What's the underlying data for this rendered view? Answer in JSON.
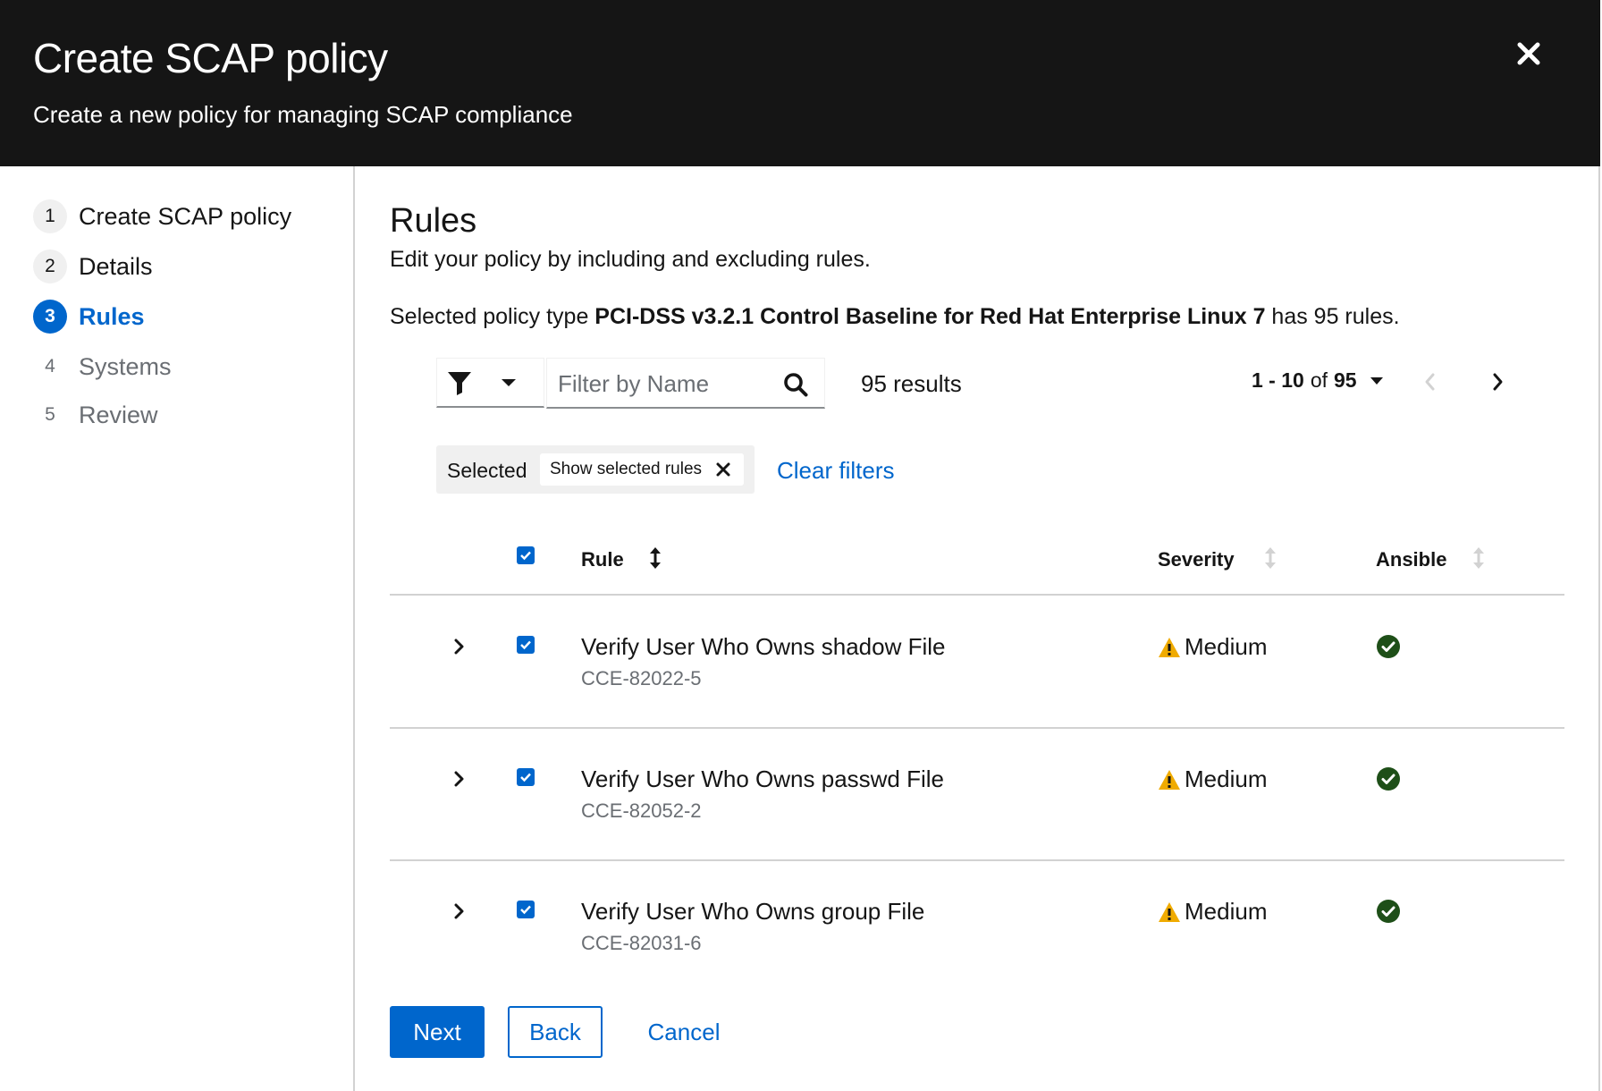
{
  "modal": {
    "title": "Create SCAP policy",
    "description": "Create a new policy for managing SCAP compliance"
  },
  "wizard_nav": {
    "items": [
      {
        "number": "1",
        "label": "Create SCAP policy",
        "state": "completed"
      },
      {
        "number": "2",
        "label": "Details",
        "state": "completed"
      },
      {
        "number": "3",
        "label": "Rules",
        "state": "current"
      },
      {
        "number": "4",
        "label": "Systems",
        "state": "disabled"
      },
      {
        "number": "5",
        "label": "Review",
        "state": "disabled"
      }
    ]
  },
  "main": {
    "title": "Rules",
    "description": "Edit your policy by including and excluding rules.",
    "policy_prefix": "Selected policy type ",
    "policy_name": "PCI-DSS v3.2.1 Control Baseline for Red Hat Enterprise Linux 7",
    "policy_suffix": " has 95 rules."
  },
  "toolbar": {
    "search_placeholder": "Filter by Name",
    "search_value": "",
    "results_text": "95 results",
    "pagination": {
      "range": "1 - 10",
      "of_text": "of",
      "total": "95"
    }
  },
  "filters": {
    "group_label": "Selected",
    "chip_label": "Show selected rules",
    "clear_label": "Clear filters"
  },
  "table": {
    "columns": {
      "rule": "Rule",
      "severity": "Severity",
      "ansible": "Ansible"
    },
    "rows": [
      {
        "name": "Verify User Who Owns shadow File",
        "id": "CCE-82022-5",
        "severity": "Medium",
        "checked": true,
        "ansible": true
      },
      {
        "name": "Verify User Who Owns passwd File",
        "id": "CCE-82052-2",
        "severity": "Medium",
        "checked": true,
        "ansible": true
      },
      {
        "name": "Verify User Who Owns group File",
        "id": "CCE-82031-6",
        "severity": "Medium",
        "checked": true,
        "ansible": true
      }
    ]
  },
  "footer": {
    "next_label": "Next",
    "back_label": "Back",
    "cancel_label": "Cancel"
  },
  "colors": {
    "header_bg": "#151515",
    "primary": "#0066cc",
    "warning": "#f0ab00",
    "success_icon": "#1e4f18",
    "border": "#d2d2d2"
  },
  "icons": {
    "close": "close-icon",
    "filter": "filter-icon",
    "caret": "caret-down-icon",
    "search": "search-icon",
    "prev": "angle-left-icon",
    "next": "angle-right-icon",
    "chip_close": "times-icon",
    "sort": "sort-icon",
    "expand": "angle-right-icon",
    "severity": "warning-triangle-icon",
    "ansible": "check-circle-icon"
  }
}
